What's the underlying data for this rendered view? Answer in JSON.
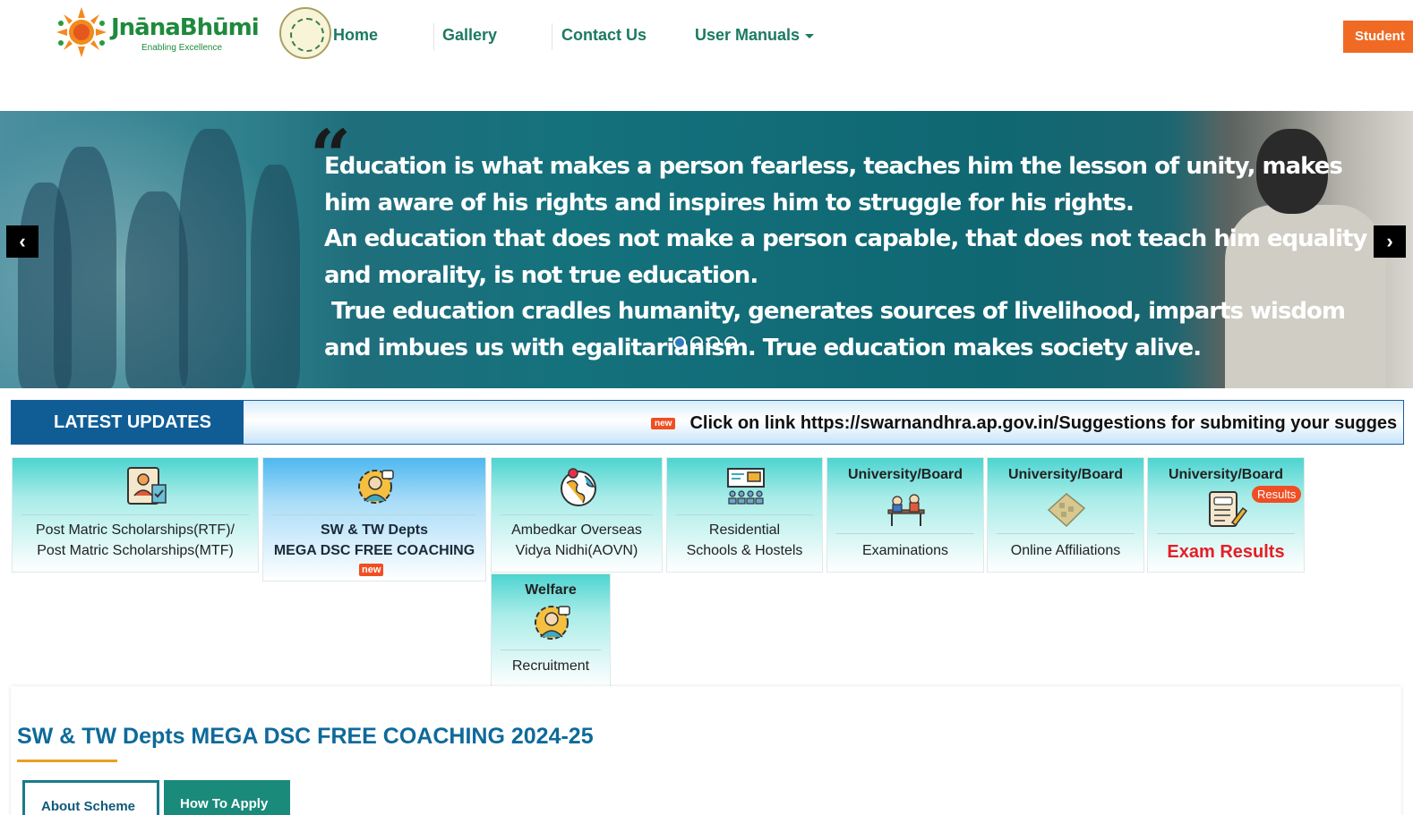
{
  "brand": {
    "name": "JnānaBhūmi",
    "tagline": "Enabling Excellence",
    "accent": "#1e8a3c"
  },
  "nav": {
    "home": "Home",
    "gallery": "Gallery",
    "contact": "Contact Us",
    "manuals": "User Manuals",
    "student_btn": "Student"
  },
  "banner": {
    "quote_lines": [
      "Education is what makes a person fearless, teaches him the lesson of unity, makes",
      "him aware of his rights and inspires him to struggle for his rights.",
      "An education that does not make a person capable, that does not teach him equality",
      "and morality, is not true education.",
      " True education cradles humanity, generates sources of livelihood, imparts wisdom",
      "and imbues us with egalitarianism. True education makes society alive."
    ],
    "slides_total": 4,
    "active_slide": 1,
    "prev_icon": "chevron-left-icon",
    "next_icon": "chevron-right-icon"
  },
  "updates": {
    "label": "LATEST UPDATES",
    "badge": "new",
    "ticker": "Click on link https://swarnandhra.ap.gov.in/Suggestions for submiting your sugges"
  },
  "tiles": {
    "pms": {
      "line1": "Post Matric Scholarships(RTF)/",
      "line2": "Post Matric Scholarships(MTF)"
    },
    "dsc": {
      "line1": "SW & TW Depts",
      "line2": "MEGA DSC FREE COACHING",
      "badge": "new"
    },
    "aovn": {
      "line1": "Ambedkar Overseas",
      "line2": "Vidya Nidhi(AOVN)"
    },
    "res": {
      "line1": "Residential",
      "line2": "Schools & Hostels"
    },
    "exam": {
      "top": "University/Board",
      "label": "Examinations"
    },
    "affil": {
      "top": "University/Board",
      "label": "Online Affiliations"
    },
    "results": {
      "top": "University/Board",
      "badge": "Results",
      "label": "Exam Results"
    },
    "welfare": {
      "top": "Welfare",
      "label": "Recruitment"
    }
  },
  "section": {
    "title": "SW & TW Depts MEGA DSC FREE COACHING 2024-25",
    "tabs": [
      "About Scheme",
      "How To Apply"
    ]
  }
}
